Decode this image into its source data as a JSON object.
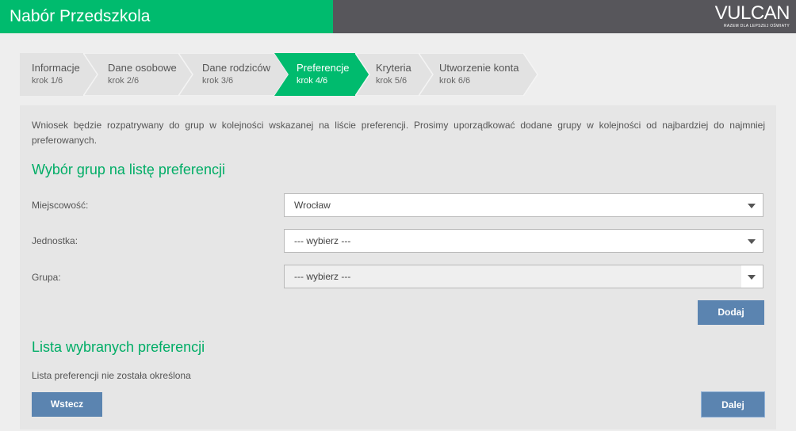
{
  "header": {
    "title": "Nabór Przedszkola",
    "logo": "VULCAN",
    "logo_tagline": "RAZEM DLA LEPSZEJ OŚWIATY",
    "brand_color": "#00bb6e",
    "dark_color": "#57565b"
  },
  "steps": [
    {
      "label": "Informacje",
      "sub": "krok 1/6"
    },
    {
      "label": "Dane osobowe",
      "sub": "krok 2/6"
    },
    {
      "label": "Dane rodziców",
      "sub": "krok 3/6"
    },
    {
      "label": "Preferencje",
      "sub": "krok 4/6",
      "active": true
    },
    {
      "label": "Kryteria",
      "sub": "krok 5/6"
    },
    {
      "label": "Utworzenie konta",
      "sub": "krok 6/6"
    }
  ],
  "main": {
    "intro": "Wniosek będzie rozpatrywany do grup w kolejności wskazanej na liście preferencji. Prosimy uporządkować dodane grupy w kolejności od najbardziej do najmniej preferowanych.",
    "section_select_title": "Wybór grup na listę preferencji",
    "fields": {
      "city": {
        "label": "Miejscowość:",
        "value": "Wrocław"
      },
      "unit": {
        "label": "Jednostka:",
        "value": "--- wybierz ---"
      },
      "group": {
        "label": "Grupa:",
        "value": "--- wybierz ---"
      }
    },
    "add_button": "Dodaj",
    "section_list_title": "Lista wybranych preferencji",
    "empty_list": "Lista preferencji nie została określona",
    "back_button": "Wstecz",
    "next_button": "Dalej"
  }
}
